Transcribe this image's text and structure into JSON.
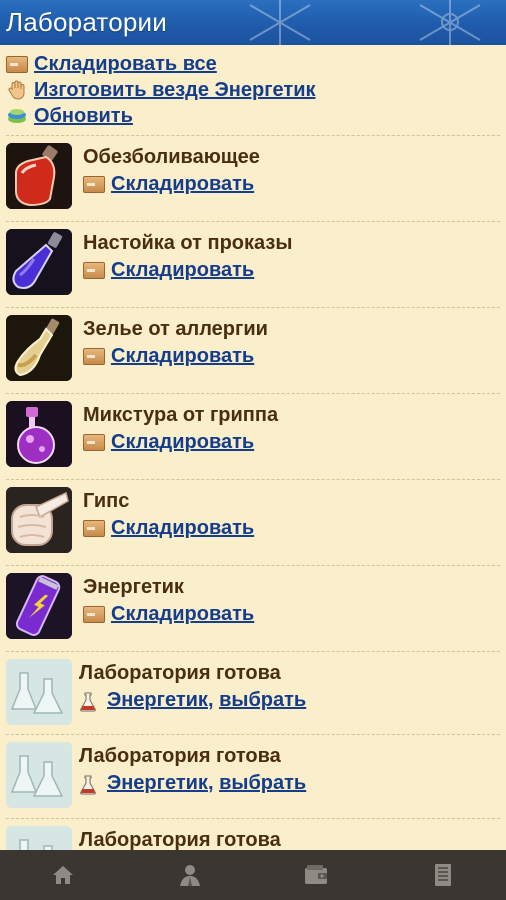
{
  "header": {
    "title": "Лаборатории"
  },
  "actions": [
    {
      "label": "Складировать все",
      "icon": "box-icon"
    },
    {
      "label": "Изготовить везде Энергетик",
      "icon": "hand-icon"
    },
    {
      "label": "Обновить",
      "icon": "refresh-icon"
    }
  ],
  "items": [
    {
      "name": "Обезболивающее",
      "action": "Складировать",
      "icon": "red-potion-icon"
    },
    {
      "name": "Настойка от проказы",
      "action": "Складировать",
      "icon": "blue-potion-icon"
    },
    {
      "name": "Зелье от аллергии",
      "action": "Складировать",
      "icon": "yellow-potion-icon"
    },
    {
      "name": "Микстура от гриппа",
      "action": "Складировать",
      "icon": "purple-potion-icon"
    },
    {
      "name": "Гипс",
      "action": "Складировать",
      "icon": "bandage-icon"
    },
    {
      "name": "Энергетик",
      "action": "Складировать",
      "icon": "energy-drink-icon"
    }
  ],
  "labs": [
    {
      "name": "Лаборатория готова",
      "product": "Энергетик",
      "select": "выбрать"
    },
    {
      "name": "Лаборатория готова",
      "product": "Энергетик",
      "select": "выбрать"
    },
    {
      "name": "Лаборатория готова"
    }
  ],
  "footer": [
    "home-icon",
    "profile-icon",
    "wallet-icon",
    "list-icon"
  ],
  "colors": {
    "header": "#1f5cab",
    "background": "#fbeecb",
    "link": "#143d8c",
    "footer": "#3b3631"
  }
}
